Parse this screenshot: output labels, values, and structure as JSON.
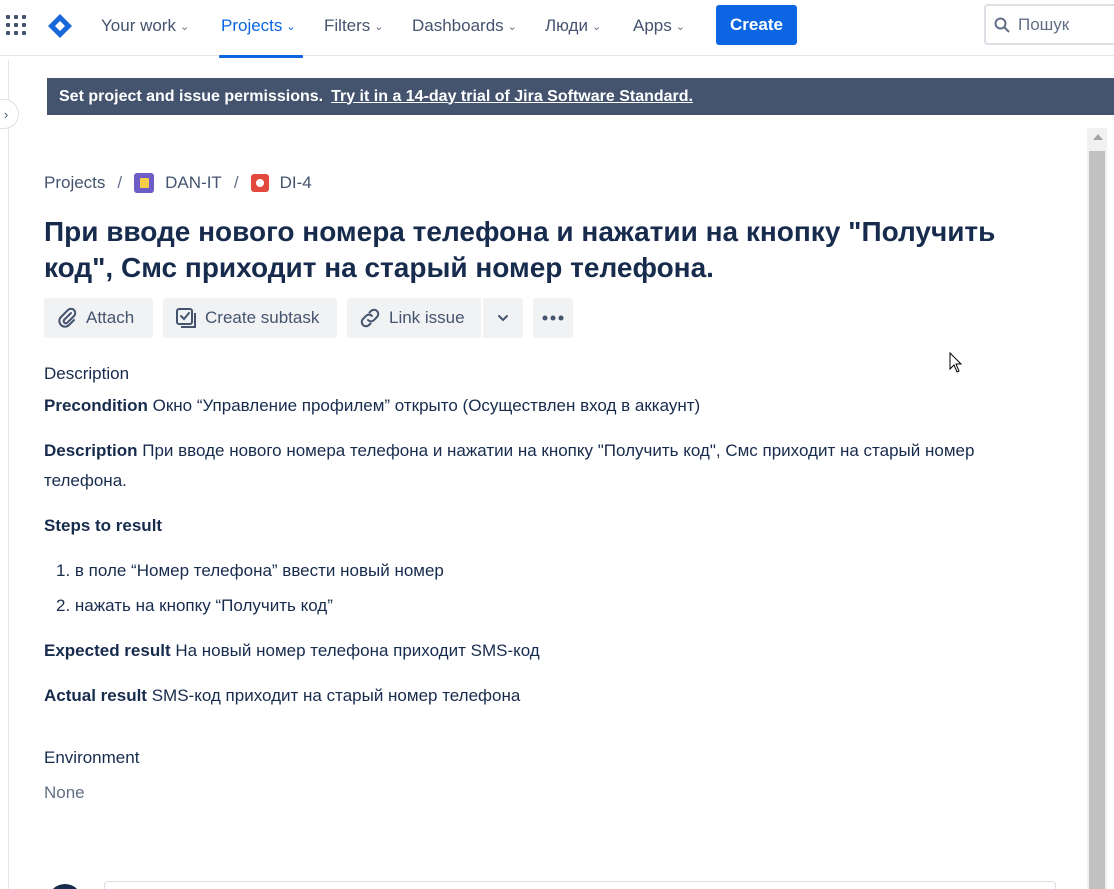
{
  "nav": {
    "items": [
      {
        "label": "Your work"
      },
      {
        "label": "Projects"
      },
      {
        "label": "Filters"
      },
      {
        "label": "Dashboards"
      },
      {
        "label": "Люди"
      },
      {
        "label": "Apps"
      }
    ],
    "create_label": "Create",
    "search_placeholder": "Пошук",
    "accent": "#0C66E4"
  },
  "banner": {
    "text": "Set project and issue permissions.",
    "link": "Try it in a 14-day trial of Jira Software Standard."
  },
  "breadcrumbs": {
    "root": "Projects",
    "project": "DAN-IT",
    "issue": "DI-4"
  },
  "issue": {
    "title": "При вводе нового номера телефона и нажатии на кнопку \"Получить код\", Смс приходит на старый номер телефона."
  },
  "toolbar": {
    "attach": "Attach",
    "create_subtask": "Create subtask",
    "link_issue": "Link issue"
  },
  "description": {
    "heading": "Description",
    "precondition_label": "Precondition",
    "precondition_text": " Окно “Управление профилем” открыто (Осуществлен вход в аккаунт)",
    "description_label": "Description",
    "description_text": " При вводе нового номера телефона и нажатии на кнопку  \"Получить код\", Смс приходит на старый номер телефона.",
    "steps_heading": "Steps to result",
    "steps": [
      {
        "num": "1.",
        "text": "в поле “Номер телефона” ввести новый номер"
      },
      {
        "num": "2.",
        "text": "нажать на кнопку “Получить код”"
      }
    ],
    "expected_label": "Expected result",
    "expected_text": " На новый номер телефона приходит SMS-код",
    "actual_label": "Actual result",
    "actual_text": " SMS-код приходит на старый номер телефона"
  },
  "environment": {
    "heading": "Environment",
    "value": "None"
  }
}
